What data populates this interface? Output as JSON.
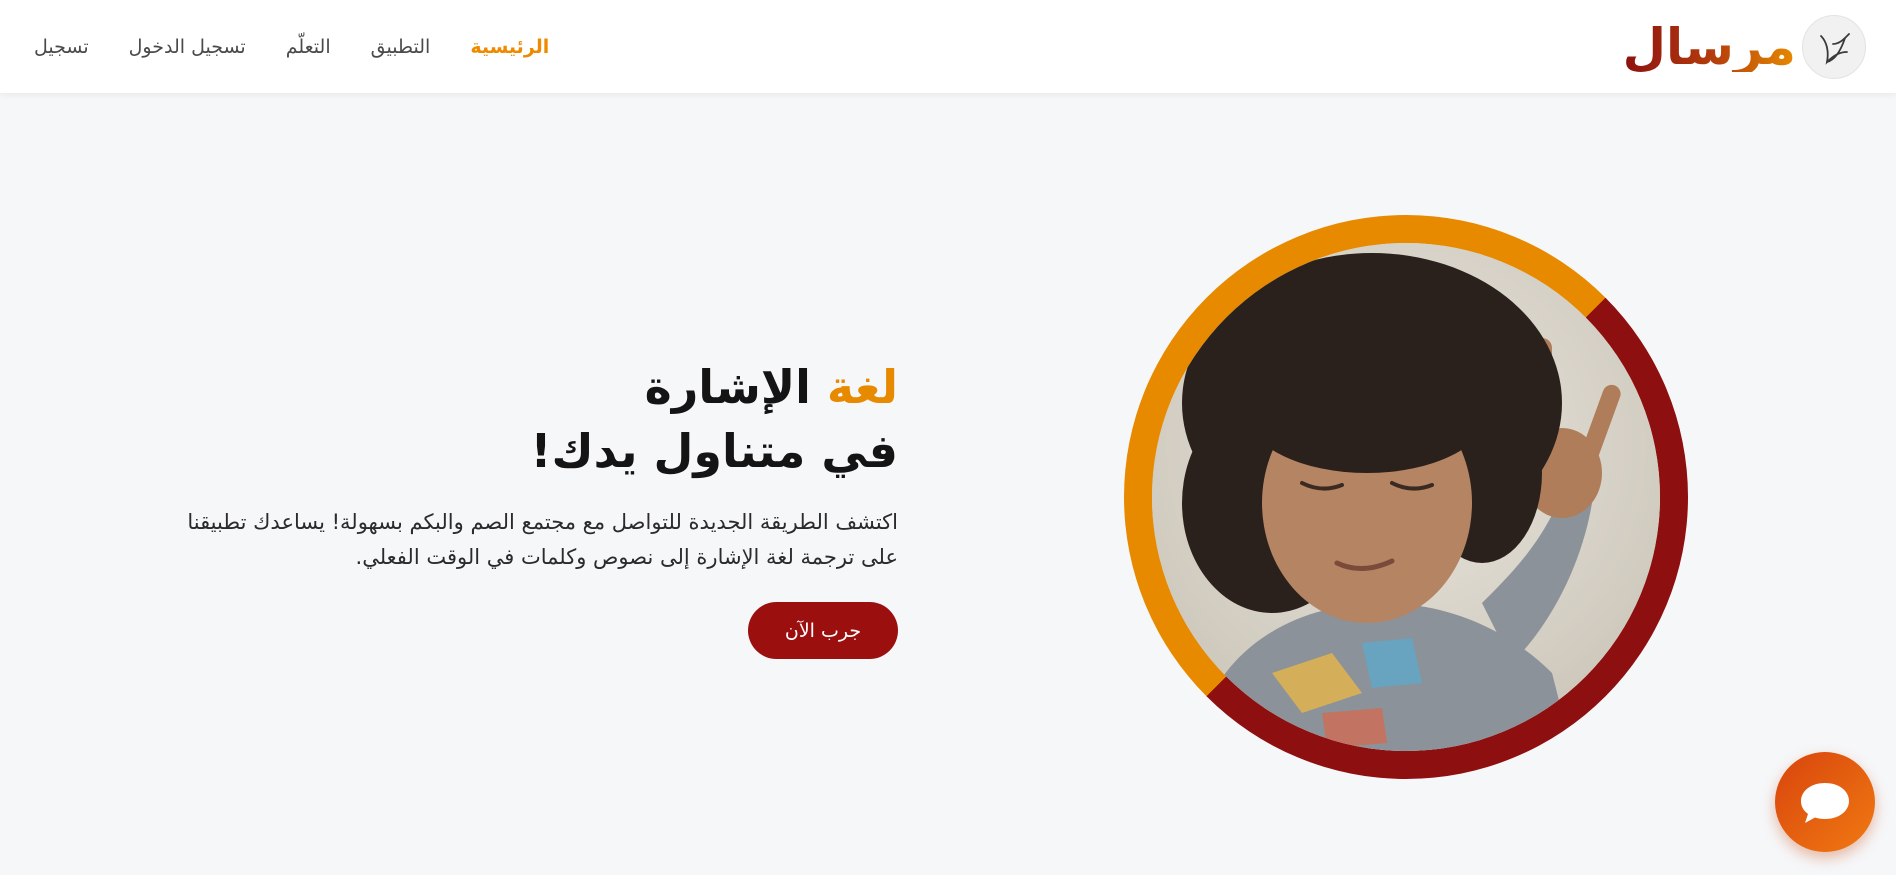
{
  "header": {
    "brand_name": "مرسال",
    "logo_icon": "dove-icon",
    "nav": [
      {
        "label": "الرئيسية",
        "active": true
      },
      {
        "label": "التطبيق",
        "active": false
      },
      {
        "label": "التعلّم",
        "active": false
      },
      {
        "label": "تسجيل الدخول",
        "active": false
      },
      {
        "label": "تسجيل",
        "active": false
      }
    ]
  },
  "hero": {
    "title_accent": "لغة",
    "title_rest": " الإشارة",
    "title_line2": "في متناول يدك!",
    "description_line1": "اكتشف الطريقة الجديدة للتواصل مع مجتمع الصم والبكم بسهولة! يساعدك تطبيقنا",
    "description_line2": "على ترجمة لغة الإشارة إلى نصوص وكلمات في الوقت الفعلي.",
    "cta_label": "جرب الآن",
    "image_icon": "child-signing-photo"
  },
  "chat": {
    "icon": "chat-bubble-icon"
  },
  "colors": {
    "accent_orange": "#e88a00",
    "brand_red": "#9b0f0f",
    "background": "#f6f7f9"
  }
}
